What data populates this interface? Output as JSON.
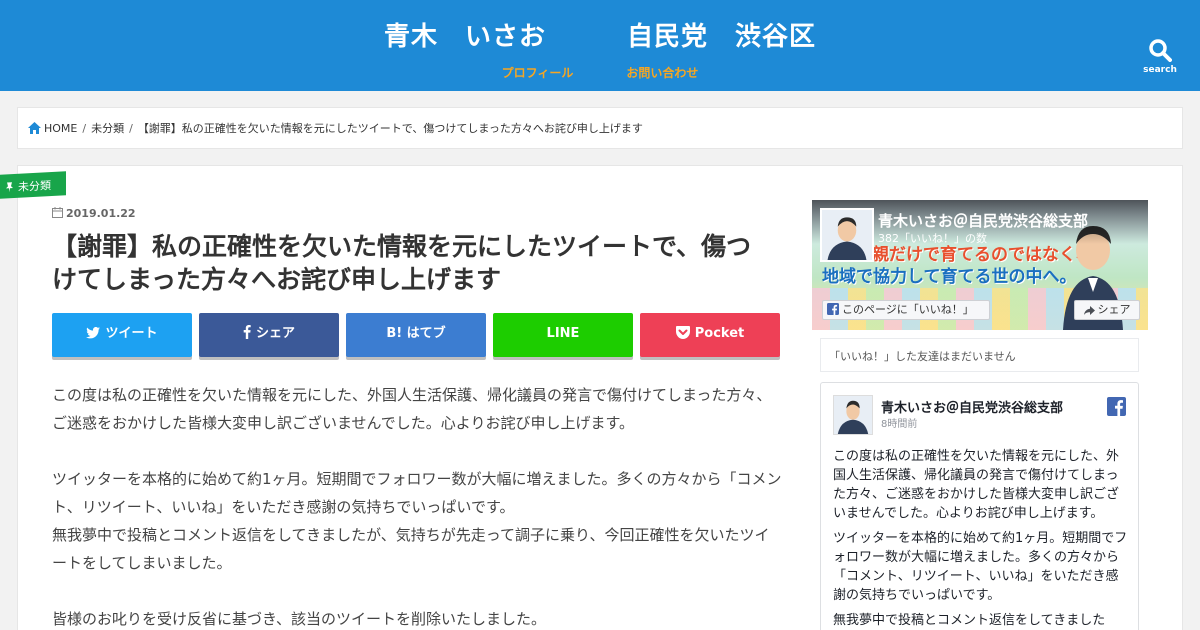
{
  "header": {
    "title": "青木　いさお　　　自民党　渋谷区",
    "nav": [
      "プロフィール",
      "お問い合わせ"
    ],
    "search_label": "search",
    "bg_color": "#1e8ad6",
    "nav_color": "#f5a623"
  },
  "breadcrumb": {
    "home": "HOME",
    "category": "未分類",
    "current": "【謝罪】私の正確性を欠いた情報を元にしたツイートで、傷つけてしまった方々へお詫び申し上げます"
  },
  "post": {
    "category": "未分類",
    "date": "2019.01.22",
    "title": "【謝罪】私の正確性を欠いた情報を元にしたツイートで、傷つけてしまった方々へお詫び申し上げます",
    "share_buttons": {
      "twitter": "ツイート",
      "facebook": "シェア",
      "hatena": "B! はてブ",
      "line": "LINE",
      "pocket": "Pocket"
    },
    "body": [
      "この度は私の正確性を欠いた情報を元にした、外国人生活保護、帰化議員の発言で傷付けてしまった方々、ご迷惑をおかけした皆様大変申し訳ございませんでした。心よりお詫び申し上げます。",
      "ツイッターを本格的に始めて約1ヶ月。短期間でフォロワー数が大幅に増えました。多くの方々から「コメント、リツイート、いいね」をいただき感謝の気持ちでいっぱいです。\n無我夢中で投稿とコメント返信をしてきましたが、気持ちが先走って調子に乗り、今回正確性を欠いたツイートをしてしまいました。",
      "皆様のお叱りを受け反省に基づき、該当のツイートを削除いたしました。"
    ]
  },
  "fb_widget": {
    "page_name": "青木いさお＠自民党渋谷総支部",
    "likes": "382「いいね！」の数",
    "cover_slogan_1": "親だけで育てるのではなく、",
    "cover_slogan_2": "地域で協力して育てる世の中へ。",
    "like_button": "このページに「いいね！」",
    "share_button": "シェア",
    "friends_text": "「いいね！」した友達はまだいません",
    "post_author": "青木いさお＠自民党渋谷総支部",
    "post_time": "8時間前",
    "post_text": [
      "この度は私の正確性を欠いた情報を元にした、外国人生活保護、帰化議員の発言で傷付けてしまった方々、ご迷惑をおかけした皆様大変申し訳ございませんでした。心よりお詫び申し上げます。",
      "ツイッターを本格的に始めて約1ヶ月。短期間でフォロワー数が大幅に増えました。多くの方々から「コメント、リツイート、いいね」をいただき感謝の気持ちでいっぱいです。",
      "無我夢中で投稿とコメント返信をしてきましたが、"
    ]
  }
}
